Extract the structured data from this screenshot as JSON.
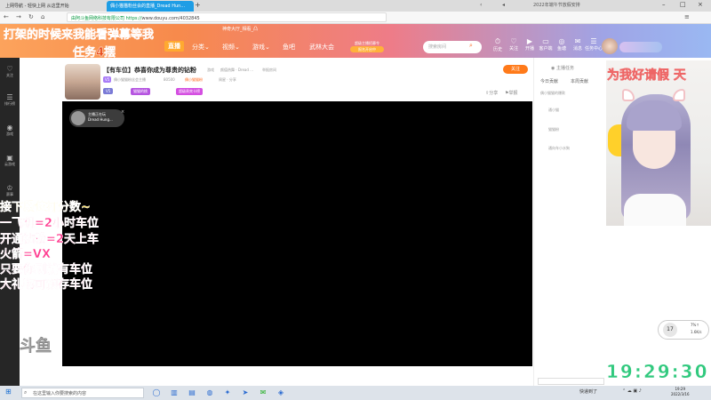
{
  "browser": {
    "tabs": [
      {
        "label": "上网导航 - 轻快上网 从这里开始"
      },
      {
        "label": "偶小猫猫粉丝会的直播_Dread Hun..."
      }
    ],
    "url_prefix": "由阿斗鱼网络科技有限公司",
    "url_scheme": "https://",
    "url_host": "www.douyu.com",
    "url_path": "/4032845",
    "top_right_text": "2022年端午节放假安排"
  },
  "header": {
    "logo": "斗鱼",
    "overlay_line1": "打架的时候来我能看弹幕等我",
    "overlay_line2": "任务4摆",
    "side_note": "神奇大厅_相看_凸",
    "nav": [
      {
        "label": "直播",
        "active": true
      },
      {
        "label": "分类"
      },
      {
        "label": "视频"
      },
      {
        "label": "游戏"
      },
      {
        "label": "鱼吧"
      },
      {
        "label": "武林大会"
      }
    ],
    "nav_tag_top": "超级主播招募令",
    "nav_tag_bottom": "报名开启中",
    "search_placeholder": "搜索房间",
    "icons": [
      {
        "name": "history",
        "label": "历史",
        "glyph": "⏱"
      },
      {
        "name": "follow",
        "label": "关注",
        "glyph": "♡"
      },
      {
        "name": "live",
        "label": "开播",
        "glyph": "▶"
      },
      {
        "name": "client",
        "label": "客户端",
        "glyph": "▭"
      },
      {
        "name": "activity",
        "label": "鱼塘",
        "glyph": "◎"
      },
      {
        "name": "message",
        "label": "消息",
        "glyph": "✉"
      },
      {
        "name": "task",
        "label": "任务中心",
        "glyph": "☰"
      }
    ]
  },
  "sidebar": [
    {
      "icon": "♡",
      "label": "关注"
    },
    {
      "icon": "☰",
      "label": "排行榜"
    },
    {
      "icon": "◉",
      "label": "游戏"
    },
    {
      "icon": "▣",
      "label": "云游戏"
    },
    {
      "icon": "♔",
      "label": "赛事"
    }
  ],
  "room": {
    "title": "【有车位】恭喜你成为尊贵的钻粉",
    "category": "游戏",
    "breadcrumb": "颜值热舞 · Dread ...",
    "report": "举报房间",
    "level_badge": "偶小猫猫粉",
    "fans_count": "80500",
    "rank": "周星 · 分享",
    "tags": [
      "V5",
      "偶小猫猫粉丝会主播"
    ],
    "badges": [
      "V5",
      "猫猫的桃",
      "超级贵宾卡榜"
    ],
    "follow": "关注",
    "share": "分享",
    "report_btn": "举报"
  },
  "video": {
    "tag_line1": "主播正在玩",
    "tag_line2": "Dread Hung..."
  },
  "overlay_lines": [
    "接下段位打分数~",
    "一飞机=2小时车位",
    "开通钻粉=2天上车",
    "火箭=VX",
    "只要你刷就有车位",
    "大礼物可预存车位"
  ],
  "right_panel": {
    "header": "主播任务",
    "tabs": [
      "今日贡献",
      "本周贡献",
      "全部"
    ],
    "items": [
      "偶小猫猫的爆款",
      "通小猫",
      "猫猫粉",
      "通向车小水狗"
    ]
  },
  "webcam": {
    "caption": "为我好请假 天"
  },
  "hint": {
    "number": "17",
    "label1": "7%↑",
    "label2": "1.6K/s"
  },
  "digits": "19:29:30",
  "watermark": "斗鱼",
  "taskbar": {
    "search": "在这里输入你要搜索的内容",
    "tray_text": "快递到了",
    "time": "19:29",
    "date": "2022/3/16"
  }
}
